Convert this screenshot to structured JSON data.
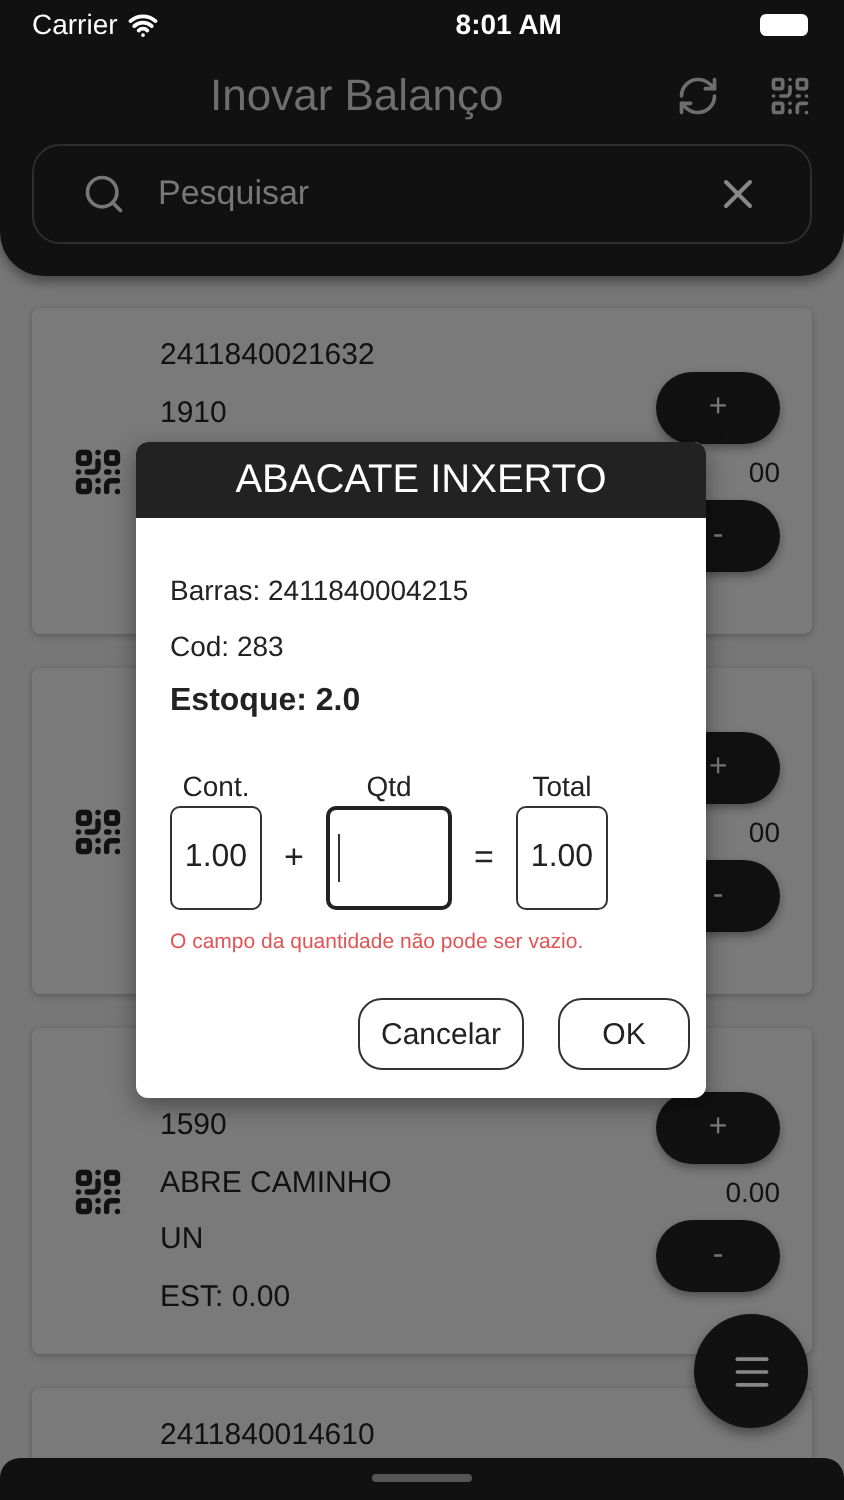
{
  "status_bar": {
    "carrier": "Carrier",
    "time": "8:01 AM"
  },
  "header": {
    "title": "Inovar Balanço",
    "search": {
      "placeholder": "Pesquisar"
    }
  },
  "cards": [
    {
      "lines": [
        "2411840021632",
        "1910"
      ],
      "value": "00",
      "buttons": [
        "+",
        "-"
      ]
    },
    {
      "value": "00",
      "buttons": [
        "+",
        "-"
      ]
    },
    {
      "lines": [
        "1590",
        "ABRE CAMINHO",
        "UN",
        "EST: 0.00"
      ],
      "value": "0.00",
      "buttons": [
        "+",
        "-"
      ]
    },
    {
      "lines": [
        "2411840014610"
      ]
    }
  ],
  "dialog": {
    "title": "ABACATE INXERTO",
    "barras": "Barras: 2411840004215",
    "cod": "Cod: 283",
    "estoque": "Estoque: 2.0",
    "fields": [
      {
        "label": "Cont.",
        "value": "1.00",
        "focused": false
      },
      {
        "label": "Qtd",
        "focused": true
      },
      {
        "label": "Total",
        "value": "1.00",
        "focused": false
      }
    ],
    "operators": [
      "+",
      "="
    ],
    "error": "O campo da quantidade não pode ser vazio.",
    "buttons": [
      "Cancelar",
      "OK"
    ]
  }
}
